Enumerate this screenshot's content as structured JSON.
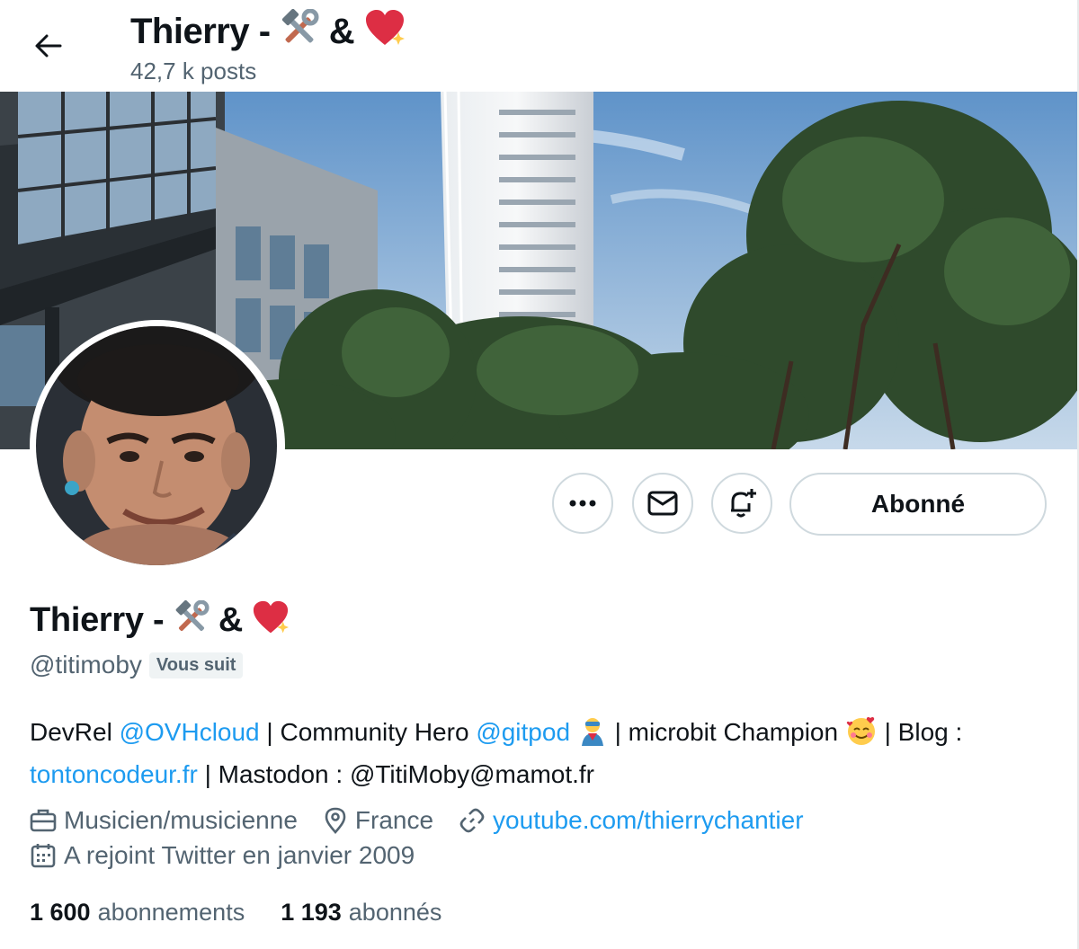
{
  "header": {
    "title": "Thierry - ",
    "title_amp": " & ",
    "posts": "42,7 k posts"
  },
  "icons": {
    "back": "arrow-left-icon",
    "more": "more-horizontal-icon",
    "message": "envelope-icon",
    "notify": "bell-plus-icon",
    "profession": "briefcase-icon",
    "location": "map-pin-icon",
    "link": "link-icon",
    "joined": "calendar-icon"
  },
  "actions": {
    "follow_label": "Abonné"
  },
  "profile": {
    "name": "Thierry - ",
    "name_amp": " & ",
    "handle": "@titimoby",
    "follows_you": "Vous suit",
    "bio": {
      "p1": "DevRel ",
      "m1": "@OVHcloud",
      "p2": " | Community Hero ",
      "m2": "@gitpod",
      "p3": " | microbit Champion ",
      "p4": " | Blog : ",
      "m3": "tontoncodeur.fr",
      "p5": " |  Mastodon : @TitiMoby@mamot.fr"
    },
    "profession": "Musicien/musicienne",
    "location": "France",
    "website": "youtube.com/thierrychantier",
    "joined": "A rejoint Twitter en janvier 2009"
  },
  "stats": {
    "following_count": "1 600",
    "following_label": "abonnements",
    "followers_count": "1 193",
    "followers_label": "abonnés"
  },
  "colors": {
    "accent": "#1d9bf0",
    "text": "#0f1419",
    "secondary": "#536471",
    "border": "#cfd9de"
  }
}
